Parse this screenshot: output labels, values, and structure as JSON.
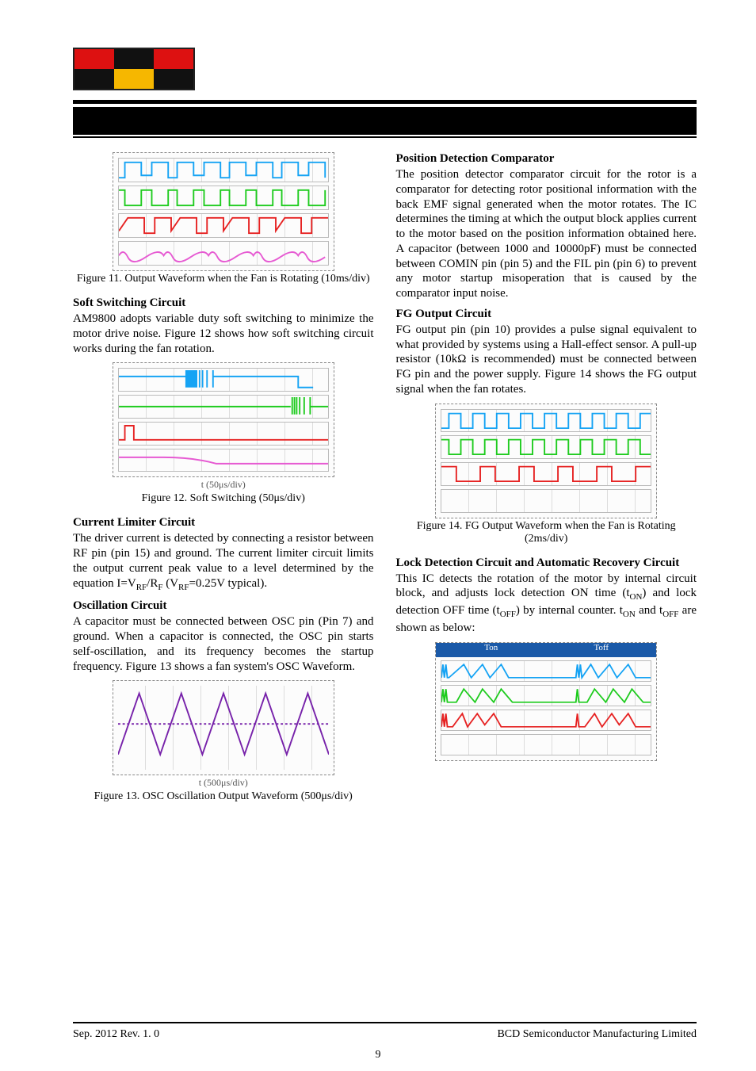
{
  "logo_alt": "BCD",
  "header_band": " ",
  "left": {
    "fig11_caption": "Figure 11. Output Waveform when the Fan is Rotating (10ms/div)",
    "soft_switch_head": "Soft Switching Circuit",
    "soft_switch_para": "AM9800 adopts variable duty soft switching to minimize the motor drive noise. Figure 12 shows how soft switching circuit works during the fan rotation.",
    "fig12_xaxis": "t (50μs/div)",
    "fig12_caption": "Figure 12. Soft Switching (50μs/div)",
    "current_limit_head": "Current Limiter Circuit",
    "current_limit_para": "The driver current is detected by connecting a resistor between RF pin (pin 15) and ground. The current limiter circuit limits the output current peak value to a level determined by the equation I=V_RF/R_F (V_RF=0.25V typical).",
    "osc_head": "Oscillation Circuit",
    "osc_para": "A capacitor must be connected between OSC pin (Pin 7) and ground. When a capacitor is connected, the OSC pin starts self-oscillation, and its frequency becomes the startup frequency. Figure 13 shows a fan system's OSC Waveform.",
    "fig13_xaxis": "t (500μs/div)",
    "fig13_caption": "Figure 13. OSC Oscillation Output Waveform (500μs/div)"
  },
  "right": {
    "posdet_head": "Position Detection Comparator",
    "posdet_para": "The position detector comparator circuit for the rotor is a comparator for detecting rotor positional information with the back EMF signal generated when the motor rotates. The IC determines the timing at which the output block applies current to the motor based on the position information obtained here. A capacitor (between 1000 and 10000pF) must be connected between COMIN pin (pin 5) and the FIL pin (pin 6) to prevent any motor startup misoperation that is caused by the comparator input noise.",
    "fg_head": "FG Output Circuit",
    "fg_para": "FG output pin (pin 10) provides a pulse signal equivalent to what provided by systems using a Hall-effect sensor. A pull-up resistor (10kΩ is recommended) must be connected between FG pin and the power supply. Figure 14 shows the FG output signal when the fan rotates.",
    "fig14_caption": "Figure 14. FG Output Waveform when the Fan is Rotating (2ms/div)",
    "lock_head": "Lock Detection Circuit and Automatic Recovery Circuit",
    "lock_para": "This IC detects the rotation of the motor by internal circuit block, and adjusts lock detection ON time (t_ON) and lock detection OFF time (t_OFF) by internal counter. t_ON and t_OFF are shown as below:",
    "fig15_label_on": "Ton",
    "fig15_label_off": "Toff"
  },
  "footer": {
    "left": "Sep. 2012   Rev. 1. 0",
    "right": "BCD Semiconductor Manufacturing Limited",
    "page": "9"
  }
}
